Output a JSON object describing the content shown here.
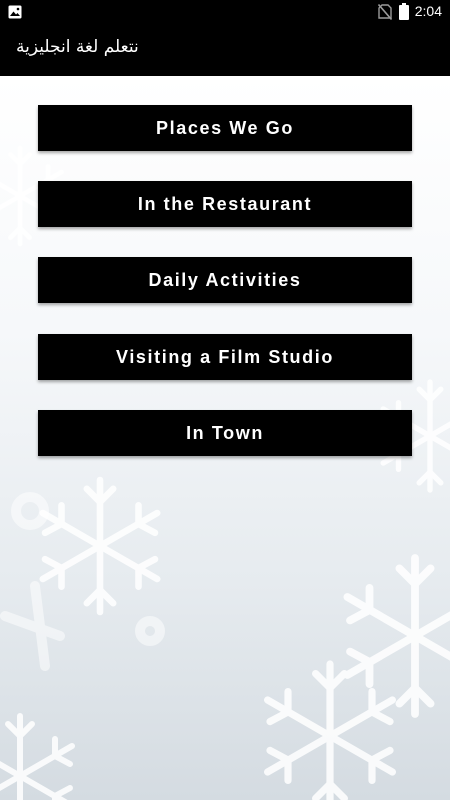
{
  "status_bar": {
    "time": "2:04",
    "icons": [
      "image-notification-icon",
      "no-sim-icon",
      "battery-icon"
    ]
  },
  "app_bar": {
    "title": "نتعلم لغة انجليزية"
  },
  "menu": {
    "items": [
      {
        "label": "Places We Go"
      },
      {
        "label": "In the Restaurant"
      },
      {
        "label": "Daily Activities"
      },
      {
        "label": "Visiting a Film Studio"
      },
      {
        "label": "In Town"
      }
    ]
  },
  "colors": {
    "bar_background": "#000000",
    "button_background": "#000000",
    "button_text": "#ffffff",
    "content_background": "#f2f5f7"
  }
}
